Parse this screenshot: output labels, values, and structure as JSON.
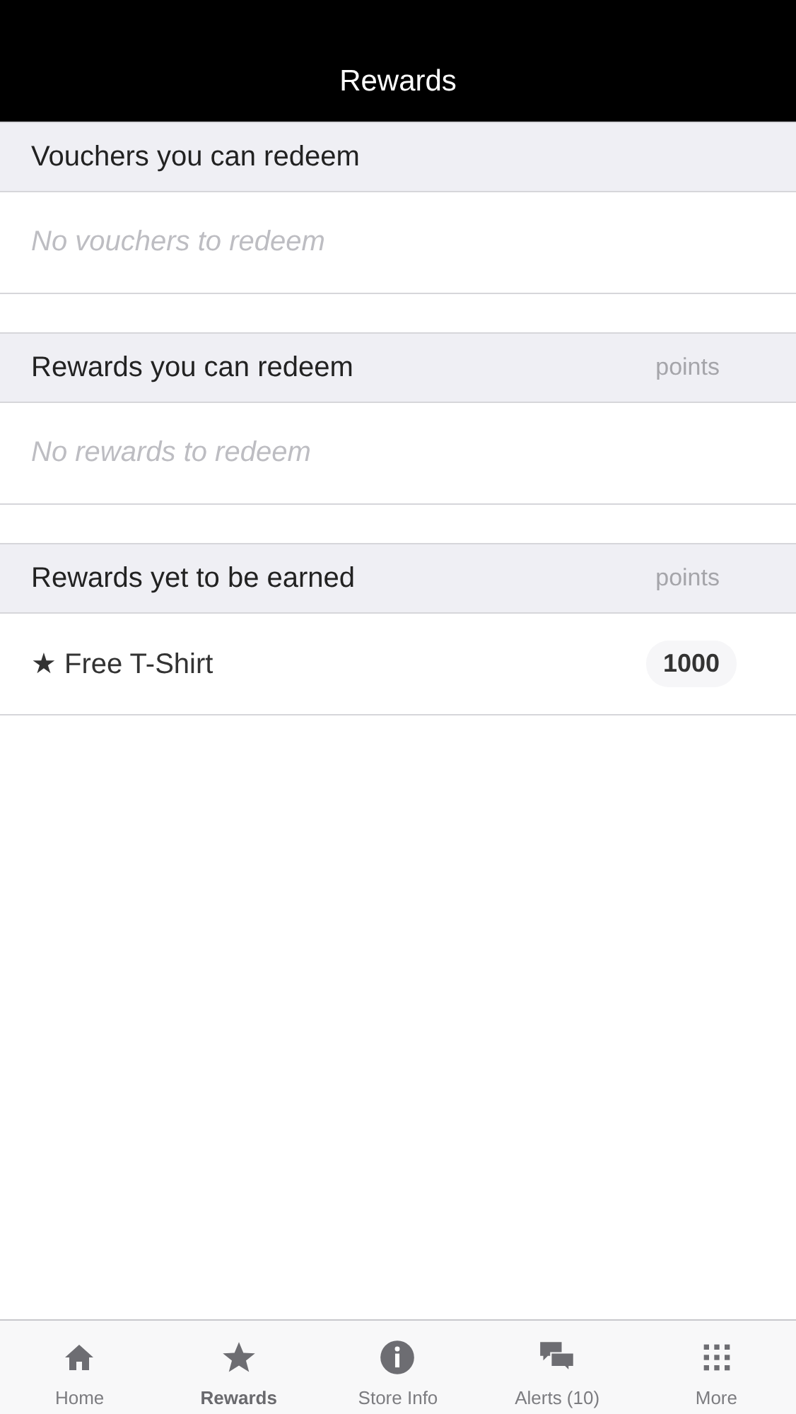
{
  "header": {
    "title": "Rewards"
  },
  "sections": [
    {
      "title": "Vouchers you can redeem",
      "empty": "No vouchers to redeem"
    },
    {
      "title": "Rewards you can redeem",
      "column": "points",
      "empty": "No rewards to redeem"
    },
    {
      "title": "Rewards yet to be earned",
      "column": "points",
      "items": [
        {
          "label": "★ Free T-Shirt",
          "points": "1000"
        }
      ]
    }
  ],
  "tab_bar": [
    {
      "kind": "home",
      "label": "Home",
      "selected": false
    },
    {
      "kind": "star",
      "label": "Rewards",
      "selected": true
    },
    {
      "kind": "info",
      "label": "Store Info",
      "selected": false
    },
    {
      "kind": "chat",
      "label": "Alerts (10)",
      "selected": false
    },
    {
      "kind": "grid",
      "label": "More",
      "selected": false
    }
  ]
}
